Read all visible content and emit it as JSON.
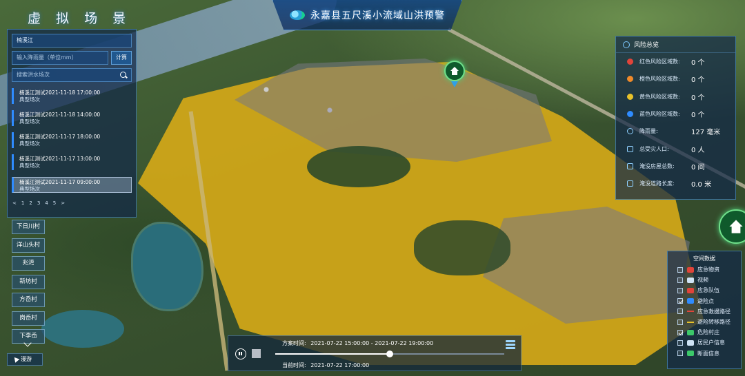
{
  "scene_title": "虚 拟 场 景",
  "header": {
    "title": "永嘉县五尺溪小流域山洪预警"
  },
  "left_panel": {
    "river_select": "楠溪江",
    "rainfall_placeholder": "输入降雨量（单位mm）",
    "calc_label": "计算",
    "search_placeholder": "搜索洪水场次",
    "scenarios": [
      {
        "title": "楠溪江测试2021-11-18 17:00:00",
        "sub": "典型场次"
      },
      {
        "title": "楠溪江测试2021-11-18 14:00:00",
        "sub": "典型场次"
      },
      {
        "title": "楠溪江测试2021-11-17 18:00:00",
        "sub": "典型场次"
      },
      {
        "title": "楠溪江测试2021-11-17 13:00:00",
        "sub": "典型场次"
      },
      {
        "title": "楠溪江测试2021-11-17 09:00:00",
        "sub": "典型场次"
      }
    ],
    "pager": [
      "<",
      "1",
      "2",
      "3",
      "4",
      "5",
      ">"
    ]
  },
  "villages": [
    "下日川村",
    "洋山头村",
    "兆湾",
    "新坊村",
    "方岙村",
    "岗岙村",
    "下李岙"
  ],
  "roam_label": "漫游",
  "risk_panel": {
    "title": "风险总览",
    "rows": [
      {
        "icon": "red-dot-icon",
        "color": "#e0443a",
        "label": "红色风险区域数:",
        "value": "0 个"
      },
      {
        "icon": "orange-dot-icon",
        "color": "#f08a2a",
        "label": "橙色风险区域数:",
        "value": "0 个"
      },
      {
        "icon": "yellow-dot-icon",
        "color": "#e8c22a",
        "label": "黄色风险区域数:",
        "value": "0 个"
      },
      {
        "icon": "blue-dot-icon",
        "color": "#2f8cff",
        "label": "蓝色风险区域数:",
        "value": "0 个"
      },
      {
        "icon": "rain-icon",
        "color": "#8fd0ff",
        "label": "降雨量:",
        "value": "127 毫米"
      },
      {
        "icon": "person-icon",
        "color": "#8fd0ff",
        "label": "总受灾人口:",
        "value": "0 人"
      },
      {
        "icon": "flooded-house-icon",
        "color": "#8fd0ff",
        "label": "淹没房屋总数:",
        "value": "0 间"
      },
      {
        "icon": "road-icon",
        "color": "#8fd0ff",
        "label": "淹没道路长度:",
        "value": "0.0 米"
      }
    ]
  },
  "space_panel": {
    "title": "空间数据",
    "items": [
      {
        "label": "应急物资",
        "checked": false,
        "icon": "supplies-icon",
        "color": "#e0443a"
      },
      {
        "label": "视频",
        "checked": false,
        "icon": "video-icon",
        "color": "#cfe3f5"
      },
      {
        "label": "应急队伍",
        "checked": false,
        "icon": "team-icon",
        "color": "#e0443a"
      },
      {
        "label": "避险点",
        "checked": true,
        "icon": "shelter-icon",
        "color": "#2f8cff"
      },
      {
        "label": "应急救援路径",
        "checked": false,
        "icon": "rescue-route-line-icon",
        "color": "#e0443a"
      },
      {
        "label": "避险转移路径",
        "checked": false,
        "icon": "evacuation-route-line-icon",
        "color": "#e8c22a"
      },
      {
        "label": "危险村庄",
        "checked": true,
        "icon": "danger-village-icon",
        "color": "#3cc86a"
      },
      {
        "label": "居民户信息",
        "checked": false,
        "icon": "resident-icon",
        "color": "#cfe3f5"
      },
      {
        "label": "断面信息",
        "checked": false,
        "icon": "section-icon",
        "color": "#3cc86a"
      }
    ]
  },
  "playback": {
    "scheme_label": "方案时间:",
    "scheme_range": "2021-07-22 15:00:00 - 2021-07-22 19:00:00",
    "current_label": "当前时间:",
    "current_time": "2021-07-22 17:00:00",
    "progress": 0.5
  }
}
